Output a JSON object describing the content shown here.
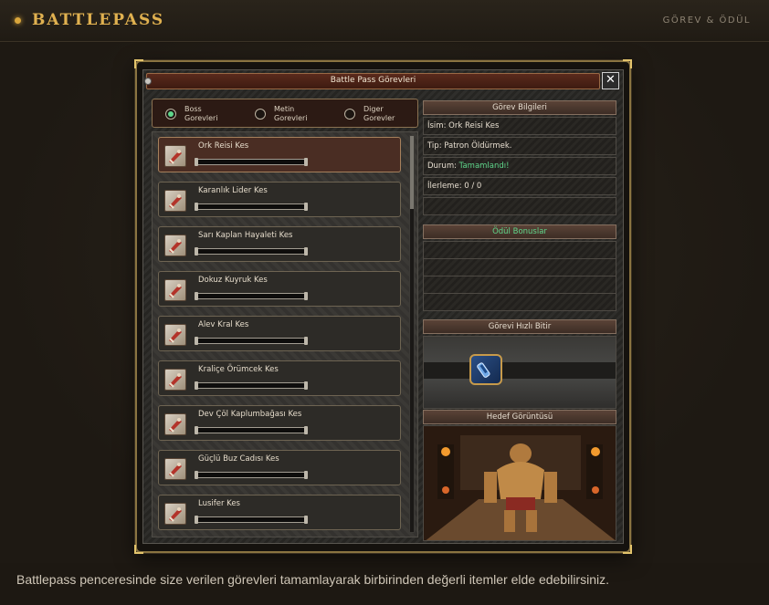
{
  "site": {
    "brand": "BATTLEPASS",
    "right_label": "GÖREV & ÖDÜL"
  },
  "window": {
    "title": "Battle Pass Görevleri",
    "close_label": "✕"
  },
  "tabs": [
    {
      "label": "Boss Gorevleri",
      "selected": true
    },
    {
      "label": "Metin Gorevleri",
      "selected": false
    },
    {
      "label": "Diger Gorevler",
      "selected": false
    }
  ],
  "missions": [
    {
      "name": "Ork Reisi Kes",
      "progress": 0,
      "active": true
    },
    {
      "name": "Karanlık Lider Kes",
      "progress": 0,
      "active": false
    },
    {
      "name": "Sarı Kaplan Hayaleti Kes",
      "progress": 0,
      "active": false
    },
    {
      "name": "Dokuz Kuyruk Kes",
      "progress": 0,
      "active": false
    },
    {
      "name": "Alev Kral Kes",
      "progress": 0,
      "active": false
    },
    {
      "name": "Kraliçe Örümcek Kes",
      "progress": 0,
      "active": false
    },
    {
      "name": "Dev Çöl Kaplumbağası Kes",
      "progress": 0,
      "active": false
    },
    {
      "name": "Güçlü Buz Cadısı Kes",
      "progress": 0,
      "active": false
    },
    {
      "name": "Lusifer Kes",
      "progress": 0,
      "active": false
    }
  ],
  "info": {
    "header": "Görev Bilgileri",
    "name_row": "İsim: Ork Reisi Kes",
    "type_row": "Tip: Patron Öldürmek.",
    "status_label": "Durum: ",
    "status_value": "Tamamlandı!",
    "progress_row": "İlerleme: 0 / 0"
  },
  "rewards": {
    "header": "Ödül Bonuslar"
  },
  "quick": {
    "header": "Görevi Hızlı Bitir"
  },
  "target": {
    "header": "Hedef Görüntüsü"
  },
  "caption": "Battlepass penceresinde size verilen görevleri tamamlayarak birbirinden değerli itemler elde edebilirsiniz.",
  "colors": {
    "accent": "#e0b150",
    "status_ok": "#5fd68b"
  }
}
